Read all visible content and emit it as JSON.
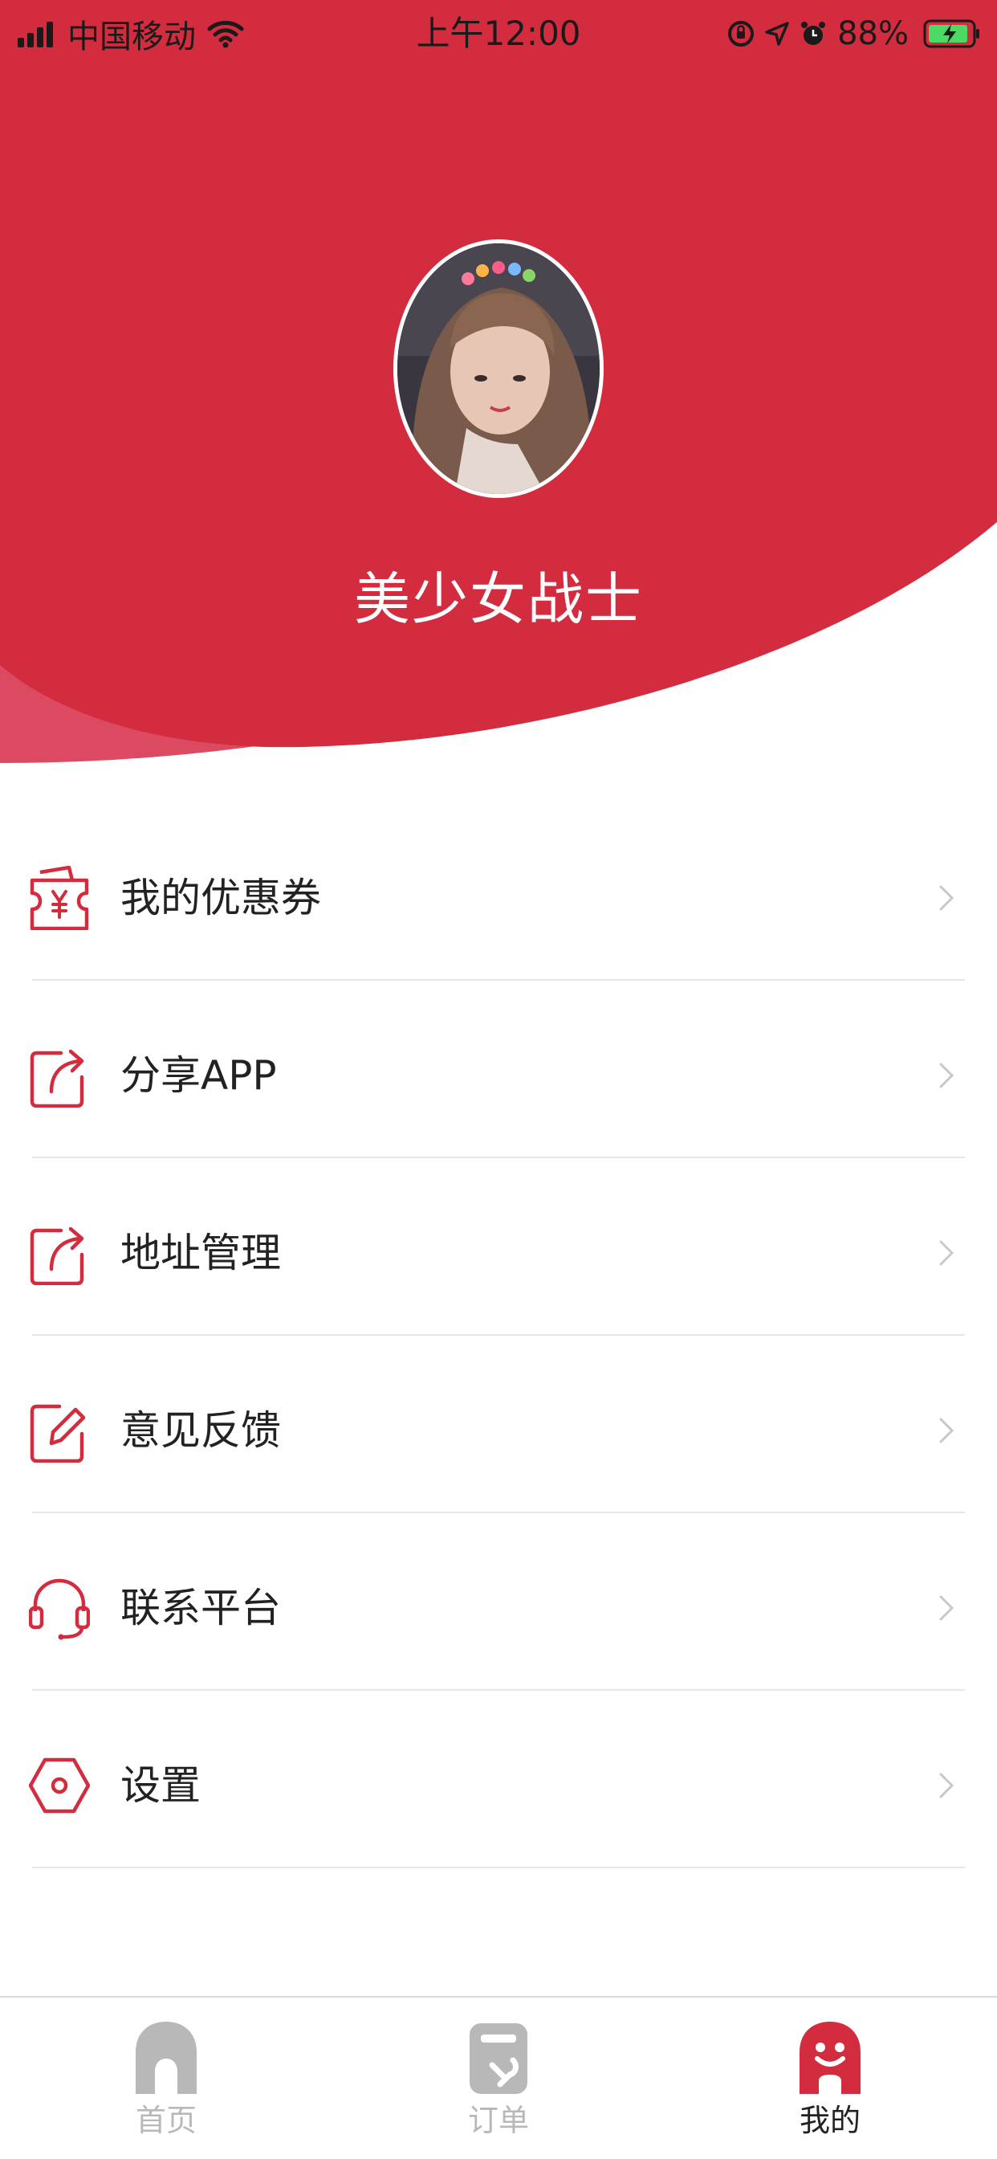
{
  "status_bar": {
    "carrier": "中国移动",
    "time": "上午12:00",
    "battery": "88%"
  },
  "profile": {
    "username": "美少女战士"
  },
  "menu": {
    "items": [
      {
        "label": "我的优惠券",
        "icon": "coupon-icon"
      },
      {
        "label": "分享APP",
        "icon": "share-icon"
      },
      {
        "label": "地址管理",
        "icon": "share-icon"
      },
      {
        "label": "意见反馈",
        "icon": "edit-icon"
      },
      {
        "label": "联系平台",
        "icon": "headset-icon"
      },
      {
        "label": "设置",
        "icon": "settings-icon"
      }
    ]
  },
  "tabbar": {
    "tabs": [
      {
        "label": "首页",
        "icon": "home-icon",
        "active": false
      },
      {
        "label": "订单",
        "icon": "order-icon",
        "active": false
      },
      {
        "label": "我的",
        "icon": "mine-icon",
        "active": true
      }
    ]
  },
  "colors": {
    "brand_red": "#d22c3e",
    "wave_light": "#dc4a62",
    "tab_active": "#d22c3e",
    "tab_inactive": "#b8b8b8"
  }
}
